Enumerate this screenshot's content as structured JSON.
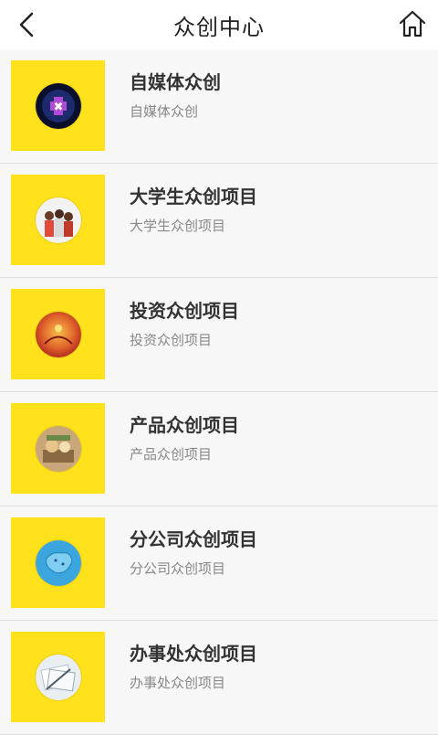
{
  "header": {
    "title": "众创中心",
    "back_icon": "chevron-left-icon",
    "home_icon": "home-icon"
  },
  "items": [
    {
      "title": "自媒体众创",
      "subtitle": "自媒体众创",
      "icon": "social-media-puzzle-head"
    },
    {
      "title": "大学生众创项目",
      "subtitle": "大学生众创项目",
      "icon": "students-group-photo"
    },
    {
      "title": "投资众创项目",
      "subtitle": "投资众创项目",
      "icon": "investment-photo"
    },
    {
      "title": "产品众创项目",
      "subtitle": "产品众创项目",
      "icon": "products-photo"
    },
    {
      "title": "分公司众创项目",
      "subtitle": "分公司众创项目",
      "icon": "china-map"
    },
    {
      "title": "办事处众创项目",
      "subtitle": "办事处众创项目",
      "icon": "office-documents-photo"
    }
  ],
  "colors": {
    "thumb_background": "#ffe11c",
    "page_background": "#f7f7f7",
    "header_background": "#ffffff"
  }
}
